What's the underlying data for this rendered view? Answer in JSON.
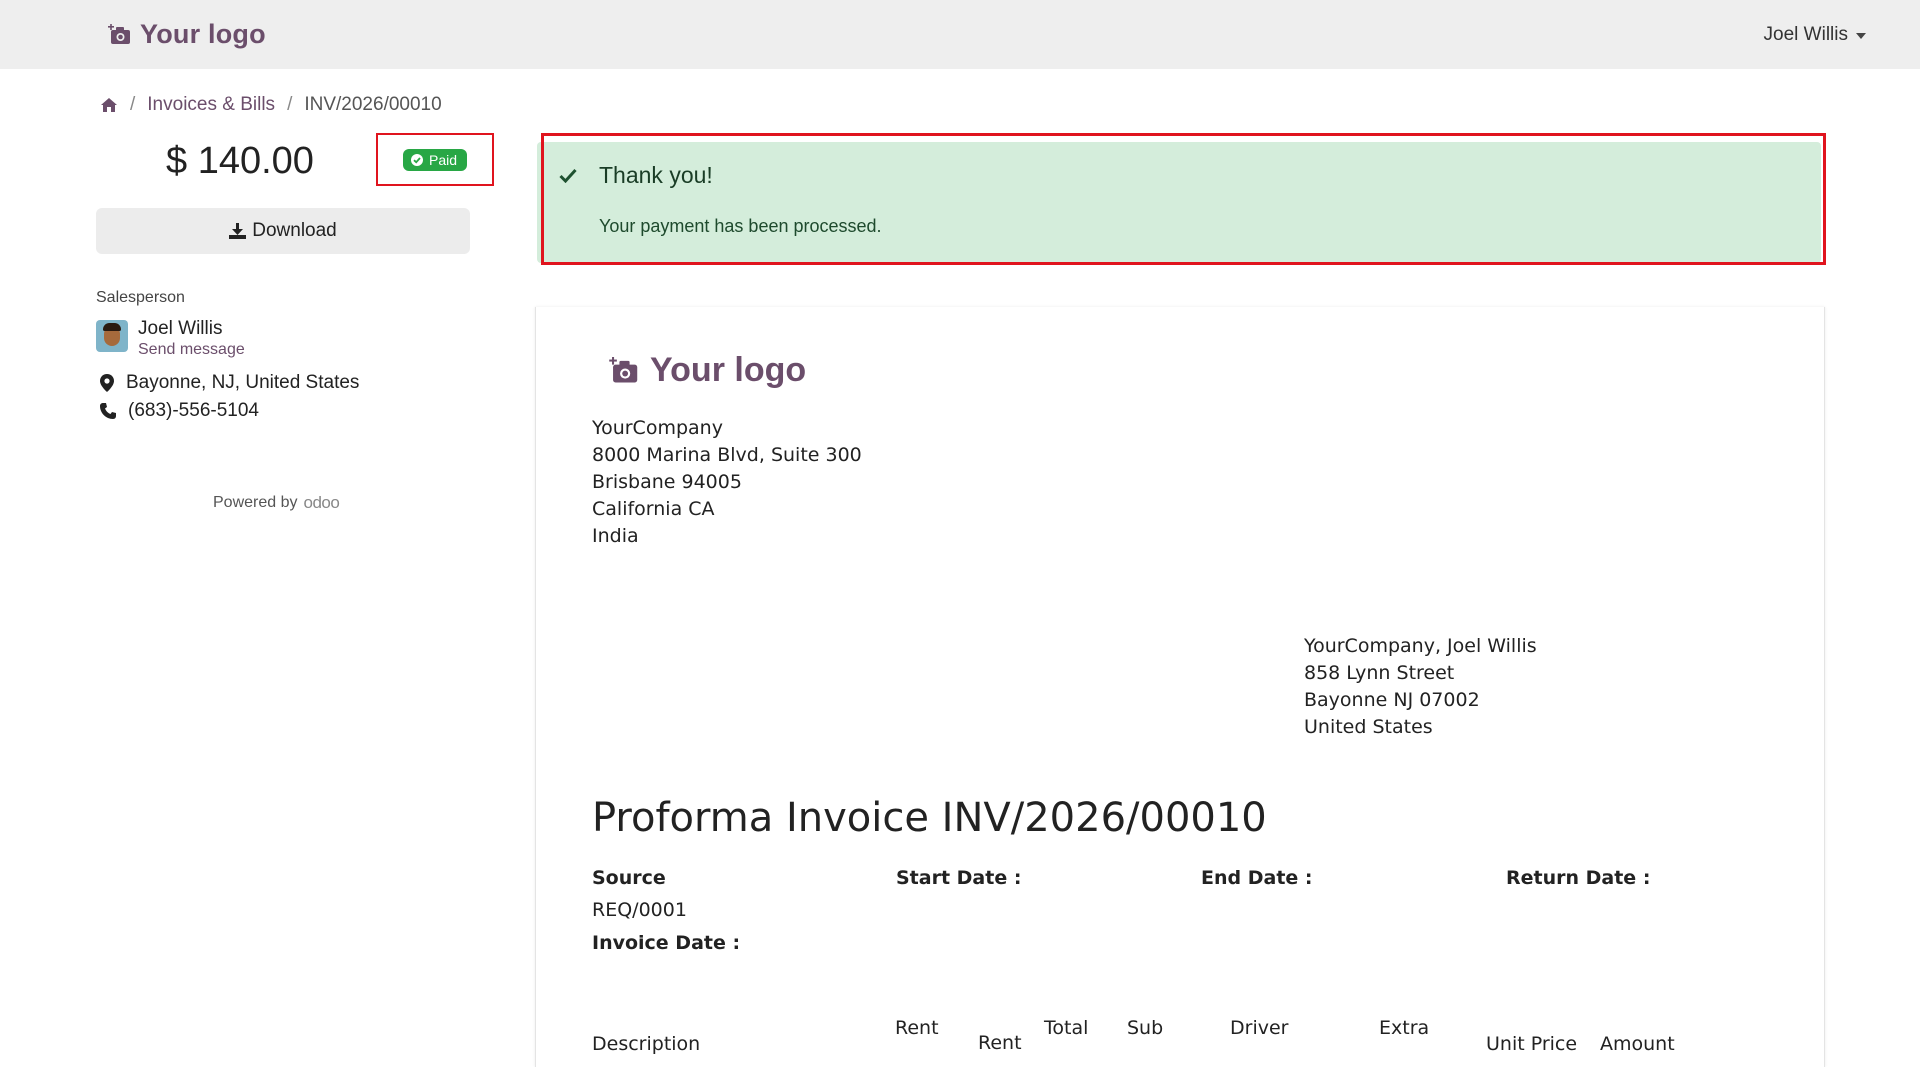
{
  "header": {
    "brand": "Your logo",
    "user": "Joel Willis"
  },
  "breadcrumb": {
    "section": "Invoices & Bills",
    "current": "INV/2026/00010"
  },
  "summary": {
    "amount": "$ 140.00",
    "status": "Paid",
    "download_label": "Download"
  },
  "salesperson": {
    "label": "Salesperson",
    "name": "Joel Willis",
    "send_message": "Send message",
    "location": "Bayonne, NJ, United States",
    "phone": "(683)-556-5104"
  },
  "powered": {
    "text": "Powered by",
    "brand": "odoo"
  },
  "alert": {
    "title": "Thank you!",
    "message": "Your payment has been processed."
  },
  "invoice": {
    "logo": "Your logo",
    "company": [
      "YourCompany",
      "8000 Marina Blvd, Suite 300",
      "Brisbane 94005",
      "California CA",
      "India"
    ],
    "client": [
      "YourCompany, Joel Willis",
      "858 Lynn Street",
      "Bayonne NJ 07002",
      "United States"
    ],
    "title": "Proforma Invoice INV/2026/00010",
    "source_label": "Source",
    "source_value": "REQ/0001",
    "invoice_date_label": "Invoice Date :",
    "start_date_label": "Start Date :",
    "end_date_label": "End Date :",
    "return_date_label": "Return Date :",
    "columns": {
      "description": "Description",
      "rent1": "Rent",
      "rent2": "Rent",
      "total": "Total",
      "sub": "Sub",
      "driver": "Driver",
      "extra": "Extra",
      "unit_price": "Unit Price",
      "amount": "Amount"
    }
  },
  "colors": {
    "brand": "#6b4e6b",
    "success_bg": "#d4eddb",
    "paid_badge": "#28a745",
    "highlight": "#e0141e"
  }
}
